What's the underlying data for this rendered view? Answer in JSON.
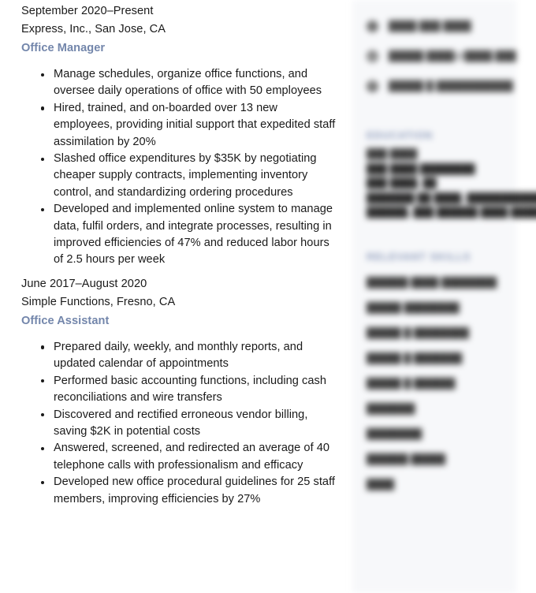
{
  "document": {
    "type": "resume-page",
    "accent_color": "#7386ab",
    "sidebar_bg": "#f7f8fa",
    "page_bg": "#ffffff",
    "text_color": "#1a1a1a"
  },
  "experience": [
    {
      "dates": "September 2020–Present",
      "company": "Express, Inc., San Jose, CA",
      "title": "Office Manager",
      "bullets": [
        "Manage schedules, organize office functions, and oversee daily operations of office with 50 employees",
        "Hired, trained, and on-boarded over 13 new employees, providing initial support that expedited staff assimilation by 20%",
        "Slashed office expenditures by $35K by negotiating cheaper supply contracts, implementing inventory control, and standardizing ordering procedures",
        "Developed and implemented online system to manage data, fulfil orders, and integrate processes, resulting in improved efficiencies of 47% and reduced labor hours of 2.5 hours per week"
      ]
    },
    {
      "dates": "June 2017–August 2020",
      "company": "Simple Functions, Fresno, CA",
      "title": "Office Assistant",
      "bullets": [
        "Prepared daily, weekly, and monthly reports, and updated calendar of appointments",
        "Performed basic accounting functions, including cash reconciliations and wire transfers",
        "Discovered and rectified erroneous vendor billing, saving $2K in potential costs",
        "Answered, screened, and redirected an average of 40 telephone calls with professionalism and efficacy",
        "Developed new office procedural guidelines for 25 staff members, improving efficiencies by 27%"
      ]
    }
  ],
  "sidebar": {
    "redacted": true,
    "contact": [
      {
        "icon": "phone-icon",
        "text": "████ ███ ████"
      },
      {
        "icon": "mail-icon",
        "text": "█████ ████@████.███"
      },
      {
        "icon": "pin-icon",
        "text": "█████ █ ███████████"
      }
    ],
    "education": {
      "heading": "EDUCATION",
      "lines": [
        {
          "text": "███ ████",
          "bold": false
        },
        {
          "text": "███ ████ ████████",
          "bold": true
        },
        {
          "text": "███ ████, ██",
          "bold": true
        },
        {
          "text": "███████ ██ ████, ████████████",
          "bold": true
        },
        {
          "text": "██████, ███ ██████ ████ █████",
          "bold": true
        }
      ]
    },
    "skills": {
      "heading": "RELEVANT SKILLS",
      "items": [
        "██████ ████ ████████",
        "█████ ████████",
        "█████ █ ████████",
        "█████ █ ███████",
        "█████ █ ██████",
        "███████",
        "████████",
        "██████ █████",
        "████"
      ]
    }
  }
}
